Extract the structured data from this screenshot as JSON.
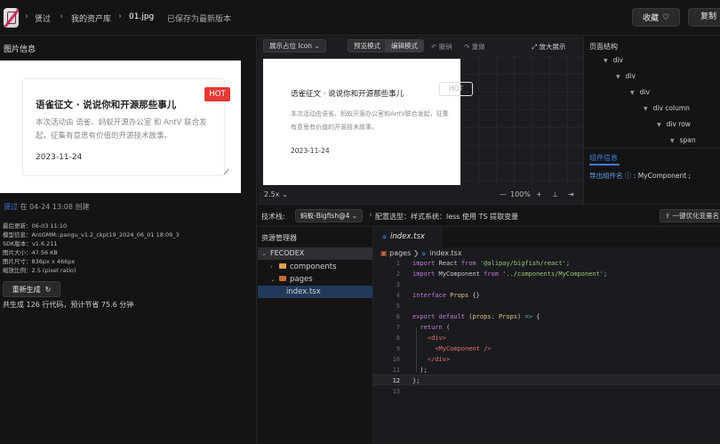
{
  "topbar": {
    "breadcrumb": [
      "贤过",
      "我的资产库",
      "01.jpg"
    ],
    "save_status": "已保存为最新版本",
    "fav_label": "收藏",
    "copy_label": "复制"
  },
  "left": {
    "title": "图片信息",
    "card": {
      "title": "语雀征文 · 说说你和开源那些事儿",
      "desc": "本次活动由 语雀、蚂蚁开源办公室 和 AntV 联合发起，征集有意思有价值的开源技术故事。",
      "date": "2023-11-24",
      "badge": "HOT"
    },
    "author": "贤过",
    "created": "在 04-24 13:08 创建",
    "meta": [
      "最后更新：06-03 11:10",
      "模型信息：AntGMM::pangu_v1.2_ckpt19_2024_06_01 18:09_3",
      "SDK版本：v1.6.211",
      "图片大小：47.56 KB",
      "图片尺寸：836px x 466px",
      "缩放比例：2.5 (pixel ratio)"
    ],
    "regen_label": "重新生成",
    "summary": "共生成 126 行代码，预计节省 75.6 分钟"
  },
  "preview": {
    "placeholder_select": "展示占位 Icon",
    "mode_preview": "预览模式",
    "mode_edit": "编辑模式",
    "undo": "撤销",
    "redo": "重做",
    "enlarge": "放大展示",
    "card_title": "语雀征文 · 说说你和开源那些事儿",
    "card_badge": "HOT",
    "card_desc": "本次活动由语雀、蚂蚁开源办公室和AntV联合发起，征集有意思有价值的开源技术故事。",
    "card_date": "2023-11-24",
    "scale": "2.5x",
    "zoom": "100%"
  },
  "structure": {
    "title": "页面结构",
    "nodes": [
      {
        "label": "div",
        "depth": 0
      },
      {
        "label": "div",
        "depth": 1
      },
      {
        "label": "div",
        "depth": 2
      },
      {
        "label": "div  column",
        "depth": 3
      },
      {
        "label": "div  row",
        "depth": 4
      },
      {
        "label": "span",
        "depth": 5
      }
    ],
    "component_title": "组件信息",
    "export_label": "导出组件名",
    "export_value": "MyComponent"
  },
  "tech": {
    "label": "技术栈:",
    "stack": "蚂蚁-Bigfish@4",
    "config": "配置选型：样式系统：less 使用 TS 提取变量",
    "optimize": "一键优化变量名"
  },
  "explorer": {
    "title": "资源管理器",
    "root": "FECODEX",
    "items": [
      {
        "label": "components",
        "type": "folder"
      },
      {
        "label": "pages",
        "type": "folder-red"
      },
      {
        "label": "index.tsx",
        "type": "ts"
      }
    ]
  },
  "editor": {
    "tab": "index.tsx",
    "crumb_folder": "pages",
    "crumb_file": "index.tsx",
    "lines": [
      "1",
      "2",
      "3",
      "4",
      "5",
      "6",
      "7",
      "8",
      "9",
      "10",
      "11",
      "12",
      "13"
    ]
  }
}
